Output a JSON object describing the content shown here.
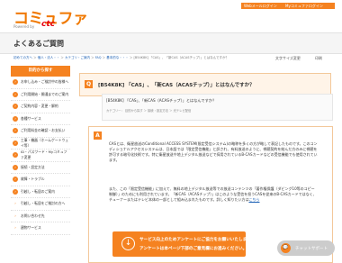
{
  "header": {
    "logo": "コミュファ",
    "logo_sub": "Powered by",
    "logo_brand": "ctc",
    "nav_web": "Webメールログイン",
    "nav_my": "Myコミュファログイン",
    "settings_icon": "gear-icon"
  },
  "page": {
    "title": "よくあるご質問",
    "breadcrumb": {
      "items": [
        "初めての方へ",
        "個人・法人・・",
        "カテゴリ・ご案内",
        "FAQ",
        "基本的な・・・",
        "映像・テレビ・・"
      ],
      "current": "[B54K8K] 「CAS」、「新CAS（ACASチップ）」とはなんですか？"
    },
    "font_size_label": "文字サイズ変更",
    "print_label": "印刷"
  },
  "sidebar": {
    "header": "目的から探す",
    "items": [
      {
        "label": "お申し込み・ご検討中の皆様へ",
        "icon": "›",
        "sub": false
      },
      {
        "label": "ご利用開始・開通までのご案内",
        "icon": "›",
        "sub": false
      },
      {
        "label": "ご契約内容・変更・解約",
        "icon": "›",
        "sub": false
      },
      {
        "label": "各種サービス",
        "icon": "›",
        "sub": false
      },
      {
        "label": "ご利用料金の確認・お支払い",
        "icon": "›",
        "sub": false
      },
      {
        "label": "工事・機器（ホームゲートウェイ等）",
        "icon": "›",
        "sub": false
      },
      {
        "label": "ID・パスワード・Myコミュファ変更",
        "icon": "›",
        "sub": false
      },
      {
        "label": "接続・設定方法",
        "icon": "›",
        "sub": false
      },
      {
        "label": "故障・トラブル",
        "icon": "›",
        "sub": false
      },
      {
        "label": "引越し・転居のご案内",
        "icon": "›",
        "sub": false
      },
      {
        "label": "引越し・転居をご検討の方へ",
        "icon": "›",
        "sub": true
      },
      {
        "label": "お問い合わせ先",
        "icon": "›",
        "sub": true
      },
      {
        "label": "建物サービス",
        "icon": "›",
        "sub": true
      }
    ]
  },
  "question": {
    "mark": "Q",
    "title": "[B54K8K] 「CAS」、「新CAS（ACASチップ）」とはなんですか？",
    "summary": "[B54K8K] 「CAS」、「新CAS（ACASチップ）」とはなんですか？",
    "category": "カテゴリー：  目的から探す ＞ 接続・設定方法 ＞ 光テレビ配信"
  },
  "answer": {
    "mark": "A",
    "p1": "CASとは、衛星放送のConditional ACCESS SYSTEM(限定受信システム)の略称を多くの方が略して表記したものです。このコンディショナルアクセスシステムは、日本語では「限定受信機能」と訳され、有料放送のように、視聴契約を結んだ方のみに視聴を許可する暗号化技術です。特に衛星放送や地上デジタル放送などで採用されているB-CASカードなどの受信機能でも使用されています。",
    "p2": "また、この「限定受信機能」に加えて、無料の地上デジタル放送等での放送コンテンツの「著作権保護（ダビング10等のコピー制御）」のためにも利用されています。「新CAS（ACASチップ）」はこのような受信を担うCASを従来のB-CASカードではなく、チューナーまたはテレビ本体の一部として組み込まれたものです。詳しく知りたい方は",
    "p2_link": "こちら"
  },
  "survey": {
    "line1": "サービス向上のためアンケートにご協力をお願いいたします。",
    "line2": "アンケートは本ページ下部のご意見欄にお進みください。",
    "icon": "arrow-down-icon"
  },
  "chat": {
    "label": "チャットサポート",
    "icon": "chat-icon"
  }
}
